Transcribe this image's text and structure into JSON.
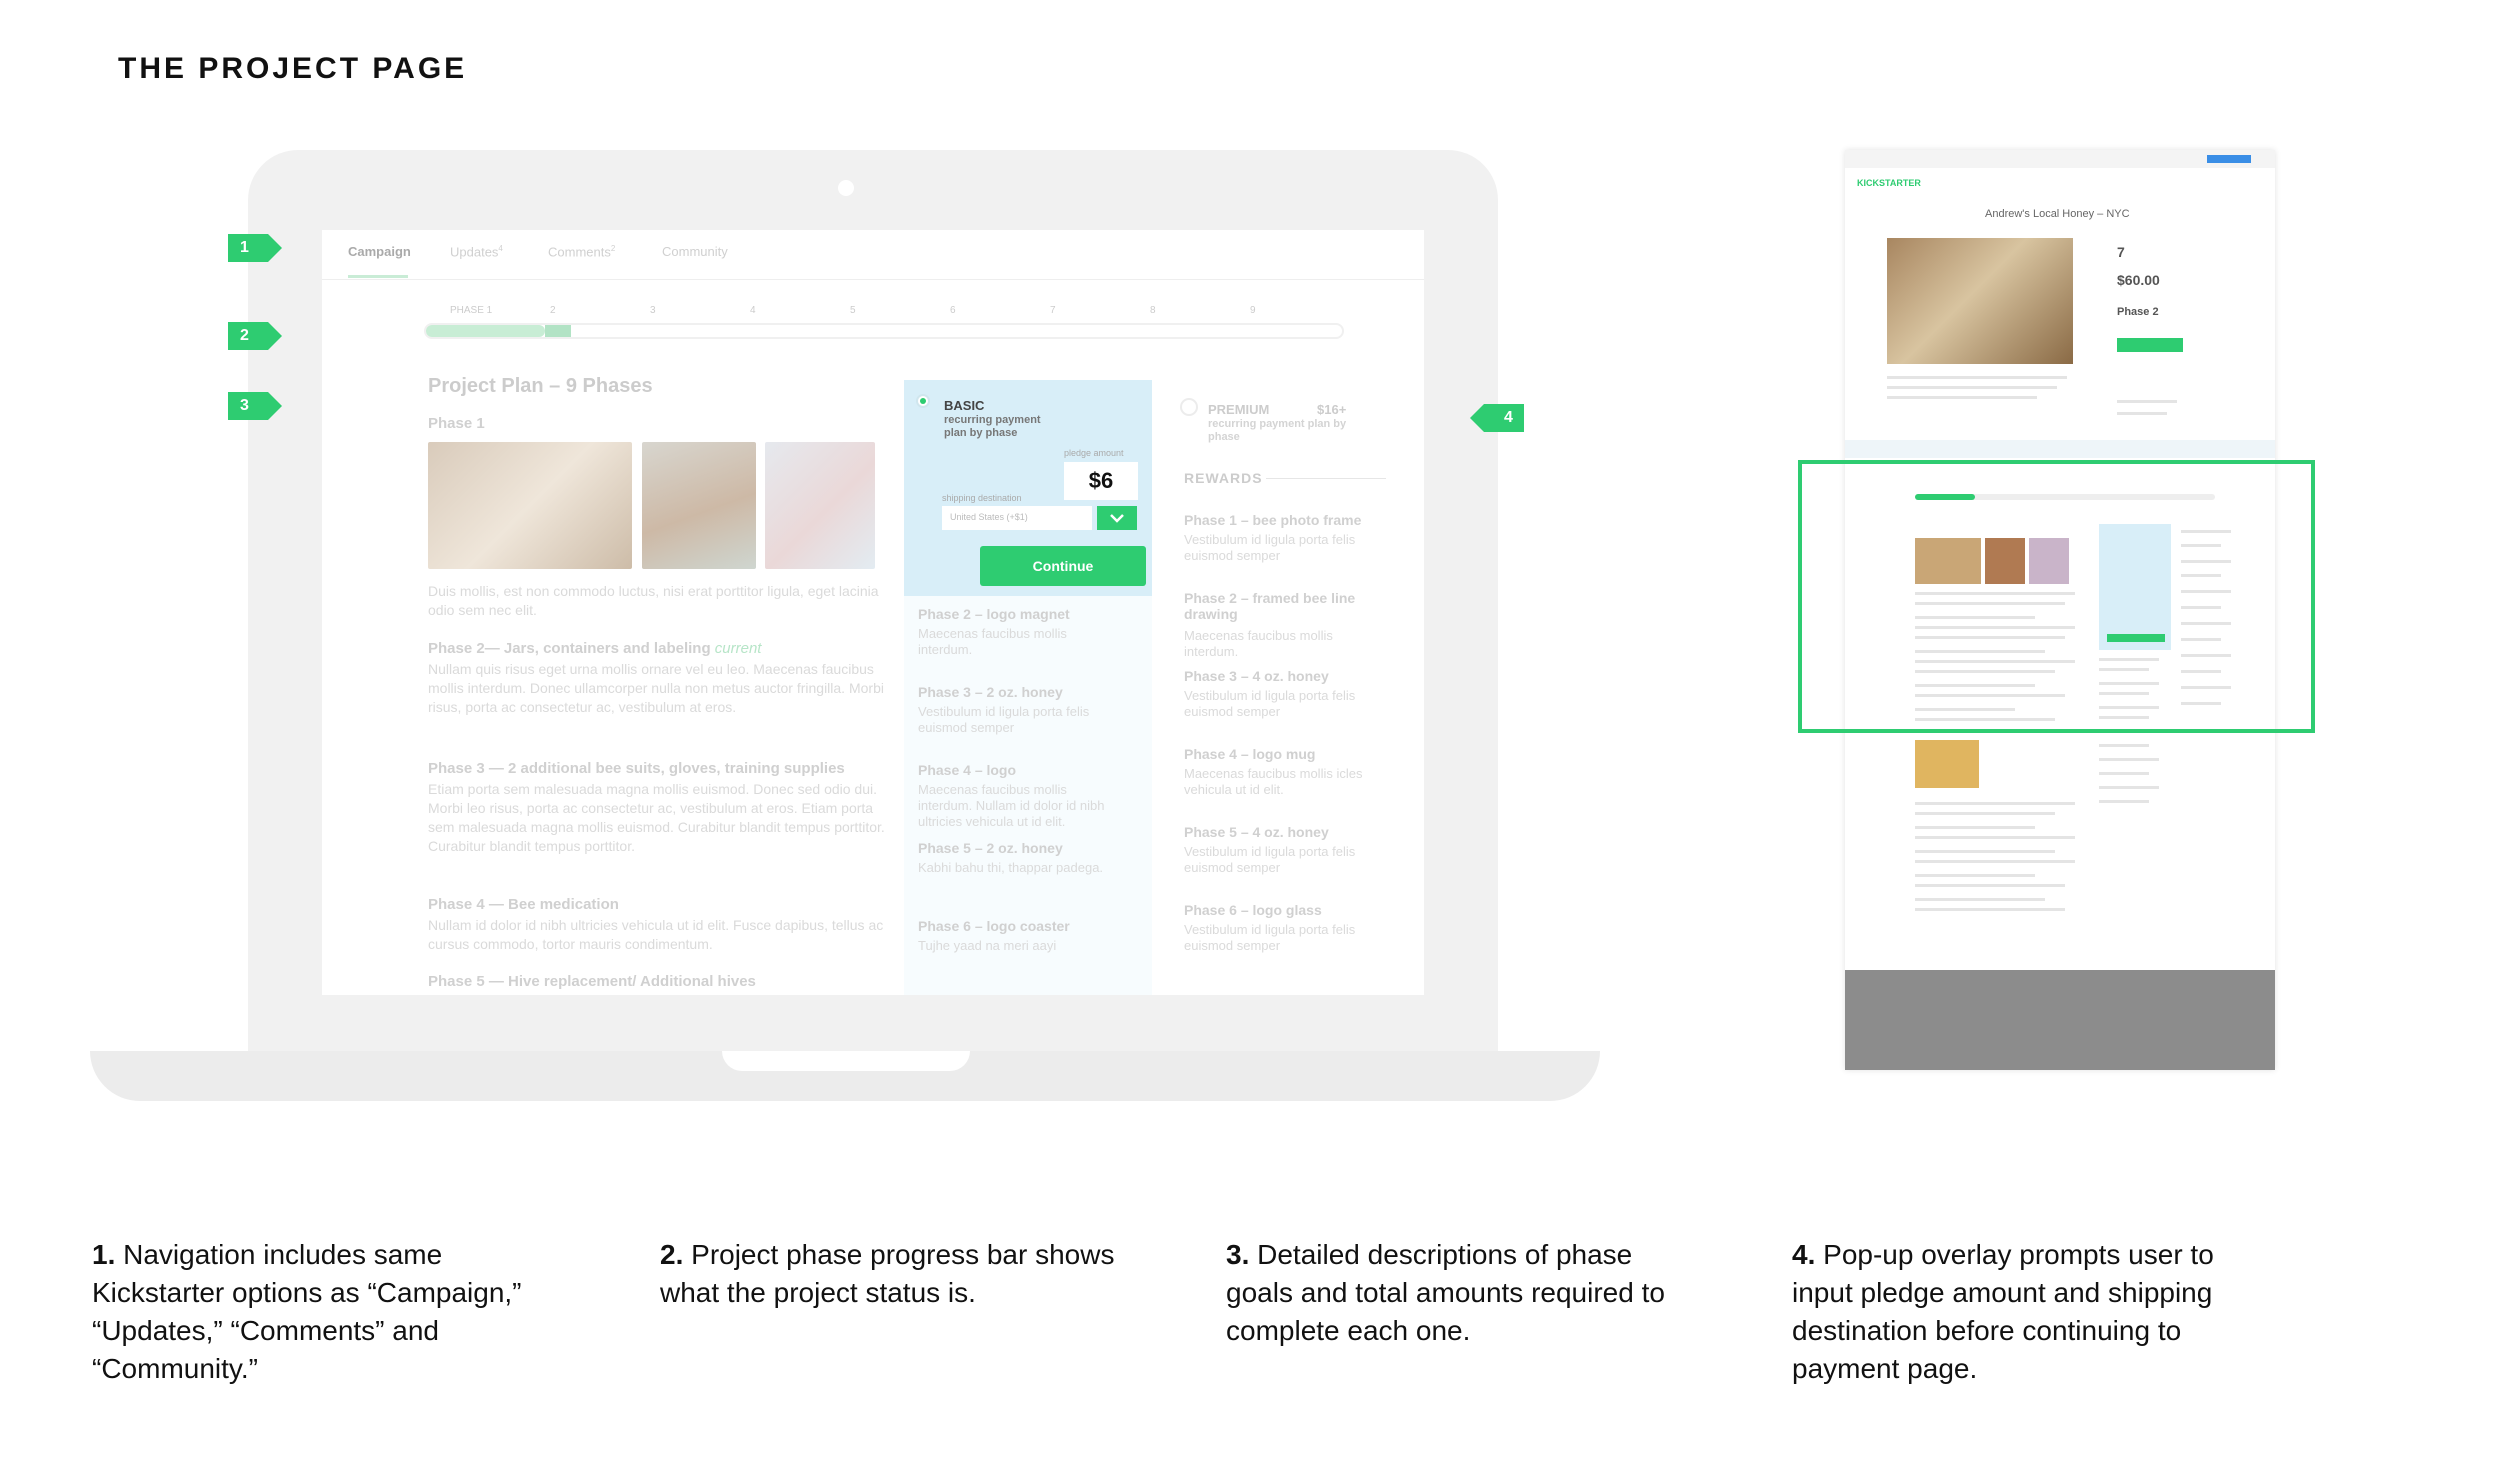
{
  "heading": "THE PROJECT PAGE",
  "badges": [
    "1",
    "2",
    "3",
    "4"
  ],
  "screen": {
    "tabs": [
      {
        "label": "Campaign"
      },
      {
        "label": "Updates",
        "sup": "4"
      },
      {
        "label": "Comments",
        "sup": "2"
      },
      {
        "label": "Community"
      }
    ],
    "progress": {
      "labels": [
        "PHASE 1",
        "2",
        "3",
        "4",
        "5",
        "6",
        "7",
        "8",
        "9"
      ],
      "fraction": 0.13
    },
    "plan_title": "Project Plan – 9 Phases",
    "phase1_title": "Phase 1",
    "phase1_text": "Duis mollis, est non commodo luctus, nisi erat porttitor ligula, eget lacinia odio sem nec elit.",
    "phases": [
      {
        "title": "Phase 2— Jars, containers and labeling",
        "tag": "current",
        "text": "Nullam quis risus eget urna mollis ornare vel eu leo. Maecenas faucibus mollis interdum. Donec ullamcorper nulla non metus auctor fringilla. Morbi risus, porta ac consectetur ac, vestibulum at eros."
      },
      {
        "title": "Phase 3 — 2 additional bee suits, gloves, training supplies",
        "text": "Etiam porta sem malesuada magna mollis euismod. Donec sed odio dui. Morbi leo risus, porta ac consectetur ac, vestibulum at eros. Etiam porta sem malesuada magna mollis euismod. Curabitur blandit tempus porttitor. Curabitur blandit tempus porttitor."
      },
      {
        "title": "Phase 4 — Bee medication",
        "text": "Nullam id dolor id nibh ultricies vehicula ut id elit. Fusce dapibus, tellus ac cursus commodo, tortor mauris condimentum."
      },
      {
        "title": "Phase 5 — Hive replacement/ Additional hives",
        "text": ""
      }
    ],
    "popup": {
      "basic_label": "BASIC",
      "basic_sub": "recurring payment plan by phase",
      "pledge_label": "pledge amount",
      "pledge_value": "$6",
      "shipping_label": "shipping destination",
      "shipping_value": "United States (+$1)",
      "continue_label": "Continue"
    },
    "basic_rewards": [
      {
        "title": "Phase 2 – logo magnet",
        "text": "Maecenas faucibus mollis interdum."
      },
      {
        "title": "Phase 3 – 2 oz. honey",
        "text": "Vestibulum id ligula porta felis euismod semper"
      },
      {
        "title": "Phase 4 – logo",
        "text": "Maecenas faucibus mollis interdum. Nullam id dolor id nibh ultricies vehicula ut id elit."
      },
      {
        "title": "Phase 5 – 2 oz. honey",
        "text": "Kabhi bahu thi, thappar padega."
      },
      {
        "title": "Phase 6 – logo coaster",
        "text": "Tujhe yaad na meri aayi"
      }
    ],
    "premium": {
      "label": "PREMIUM",
      "price": "$16+",
      "sub": "recurring payment plan by phase",
      "rewards_heading": "REWARDS",
      "rewards": [
        {
          "title": "Phase 1 – bee photo frame",
          "text": "Vestibulum id ligula porta felis euismod semper"
        },
        {
          "title": "Phase 2 – framed bee line drawing",
          "text": "Maecenas faucibus mollis interdum."
        },
        {
          "title": "Phase 3 – 4 oz. honey",
          "text": "Vestibulum id ligula porta felis euismod semper"
        },
        {
          "title": "Phase 4 – logo mug",
          "text": "Maecenas faucibus mollis icles vehicula ut id elit."
        },
        {
          "title": "Phase 5 – 4 oz. honey",
          "text": "Vestibulum id ligula porta felis euismod semper"
        },
        {
          "title": "Phase 6 – logo glass",
          "text": "Vestibulum id ligula porta felis euismod semper"
        }
      ]
    }
  },
  "thumbnail": {
    "logo": "KICKSTARTER",
    "title": "Andrew's Local Honey – NYC",
    "backers": "7",
    "pledged": "$60.00",
    "phase": "Phase 2"
  },
  "captions": [
    {
      "num": "1.",
      "text": "Navigation includes same Kickstarter options as “Campaign,” “Updates,” “Comments” and “Community.”"
    },
    {
      "num": "2.",
      "text": "Project phase progress bar shows what the project status is."
    },
    {
      "num": "3.",
      "text": "Detailed descriptions of phase goals and total amounts required to complete each one."
    },
    {
      "num": "4.",
      "text": "Pop-up overlay prompts user to input pledge amount and shipping destination before continuing to payment page."
    }
  ],
  "colors": {
    "accent": "#2ecc71",
    "popup": "#d8eef8"
  }
}
